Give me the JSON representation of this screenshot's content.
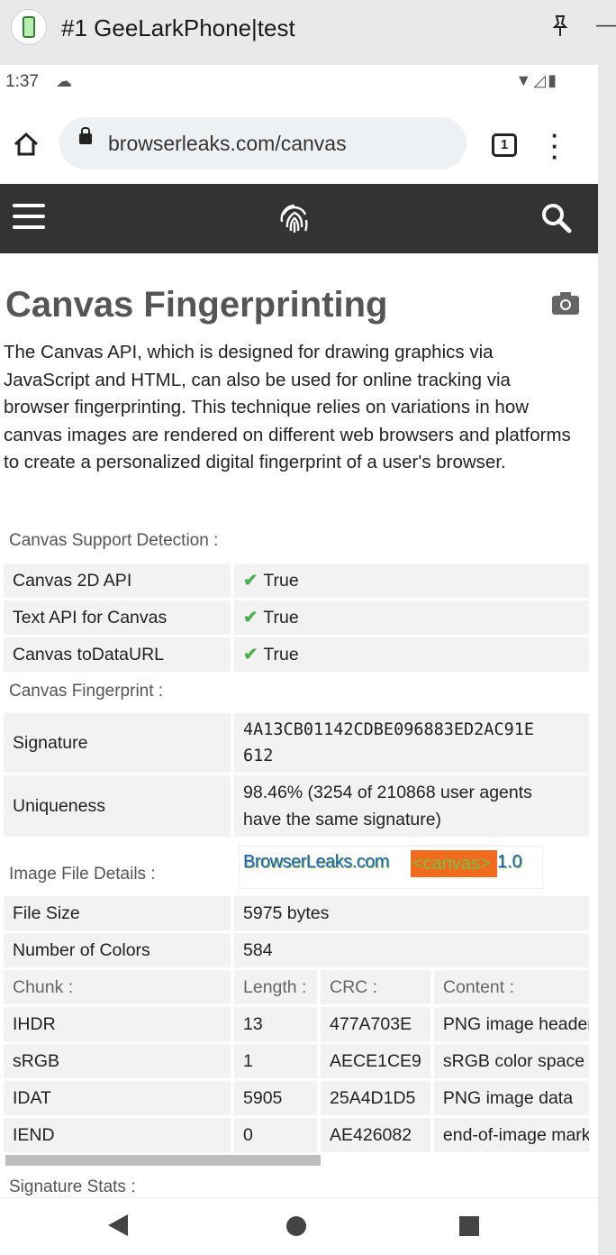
{
  "window": {
    "title": "#1 GeeLarkPhone|test"
  },
  "status": {
    "time": "1:37"
  },
  "browser": {
    "url": "browserleaks.com/canvas",
    "tab_count": "1"
  },
  "page": {
    "title": "Canvas Fingerprinting",
    "intro": "The Canvas API, which is designed for drawing graphics via JavaScript and HTML, can also be used for online tracking via browser fingerprinting. This technique relies on variations in how canvas images are rendered on different web browsers and platforms to create a personalized digital fingerprint of a user's browser."
  },
  "support": {
    "label": "Canvas Support Detection :",
    "rows": [
      {
        "key": "Canvas 2D API",
        "value": "True"
      },
      {
        "key": "Text API for Canvas",
        "value": "True"
      },
      {
        "key": "Canvas toDataURL",
        "value": "True"
      }
    ],
    "check_color": "#4caf50"
  },
  "fingerprint": {
    "label": "Canvas Fingerprint :",
    "signature_key": "Signature",
    "signature_line1": "4A13CB01142CDBE096883ED2AC91E",
    "signature_line2": "612",
    "uniqueness_key": "Uniqueness",
    "uniqueness_line1": "98.46% (3254 of 210868 user agents",
    "uniqueness_line2": "have the same signature)"
  },
  "image": {
    "label": "Image File Details :",
    "canvas_text_a": "BrowserLeaks.com",
    "canvas_text_b": "<canvas>",
    "canvas_text_c": "1.0",
    "rows": [
      {
        "key": "File Size",
        "value": "5975 bytes"
      },
      {
        "key": "Number of Colors",
        "value": "584"
      }
    ]
  },
  "chunks": {
    "headers": [
      "Chunk :",
      "Length :",
      "CRC :",
      "Content :"
    ],
    "rows": [
      [
        "IHDR",
        "13",
        "477A703E",
        "PNG image header"
      ],
      [
        "sRGB",
        "1",
        "AECE1CE9",
        "sRGB color space"
      ],
      [
        "IDAT",
        "5905",
        "25A4D1D5",
        "PNG image data"
      ],
      [
        "IEND",
        "0",
        "AE426082",
        "end-of-image marker"
      ]
    ]
  },
  "signature_stats": {
    "label": "Signature Stats :"
  },
  "colors": {
    "sitebar": "#333333",
    "accent_orange": "#f16b1f",
    "canvas_blue": "#1d5ec4"
  }
}
